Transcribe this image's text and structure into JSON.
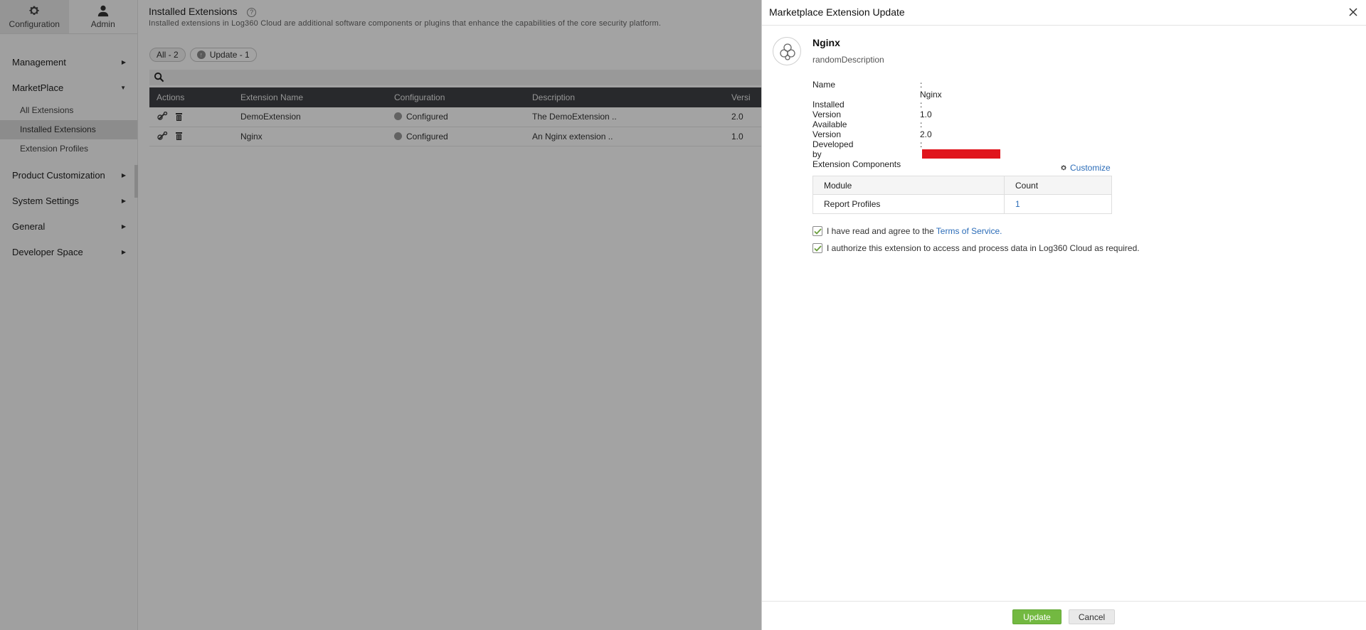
{
  "sidebar": {
    "tabs": [
      {
        "label": "Configuration",
        "icon": "gear-icon"
      },
      {
        "label": "Admin",
        "icon": "user-icon"
      }
    ],
    "nav": [
      {
        "label": "Management"
      },
      {
        "label": "MarketPlace"
      },
      {
        "label": "Product Customization"
      },
      {
        "label": "System Settings"
      },
      {
        "label": "General"
      },
      {
        "label": "Developer Space"
      }
    ],
    "marketplace_items": [
      {
        "label": "All Extensions"
      },
      {
        "label": "Installed Extensions"
      },
      {
        "label": "Extension Profiles"
      }
    ]
  },
  "main": {
    "title": "Installed Extensions",
    "help": "?",
    "description": "Installed extensions in Log360 Cloud are additional software components or plugins that enhance the capabilities of the core security platform.",
    "filters": [
      {
        "label": "All - 2"
      },
      {
        "label": "Update - 1"
      }
    ],
    "table": {
      "headers": [
        "Actions",
        "Extension Name",
        "Configuration",
        "Description",
        "Versi"
      ],
      "rows": [
        {
          "name": "DemoExtension",
          "config": "Configured",
          "description": "The DemoExtension ..",
          "version": "2.0"
        },
        {
          "name": "Nginx",
          "config": "Configured",
          "description": "An Nginx extension ..",
          "version": "1.0"
        }
      ]
    }
  },
  "drawer": {
    "title": "Marketplace Extension Update",
    "extension_name": "Nginx",
    "extension_description": "randomDescription",
    "info": [
      {
        "label": "Name",
        "value": ": Nginx"
      },
      {
        "label": "Installed Version",
        "value": ": 1.0"
      },
      {
        "label": "Available Version",
        "value": ": 2.0"
      },
      {
        "label": "Developed by",
        "value": ":"
      }
    ],
    "components_label": "Extension Components",
    "customize_label": "Customize",
    "components_table": {
      "headers": [
        "Module",
        "Count"
      ],
      "rows": [
        {
          "module": "Report Profiles",
          "count": "1"
        }
      ]
    },
    "agree_text": "I have read and agree to the",
    "terms_link": "Terms of Service.",
    "authorize_text": "I authorize this extension to access and process data in Log360 Cloud as required.",
    "update_button": "Update",
    "cancel_button": "Cancel"
  },
  "colors": {
    "accent": "#73b941",
    "link": "#2b6cb8",
    "table_header": "#3f4146",
    "redacted": "#e0151c"
  }
}
